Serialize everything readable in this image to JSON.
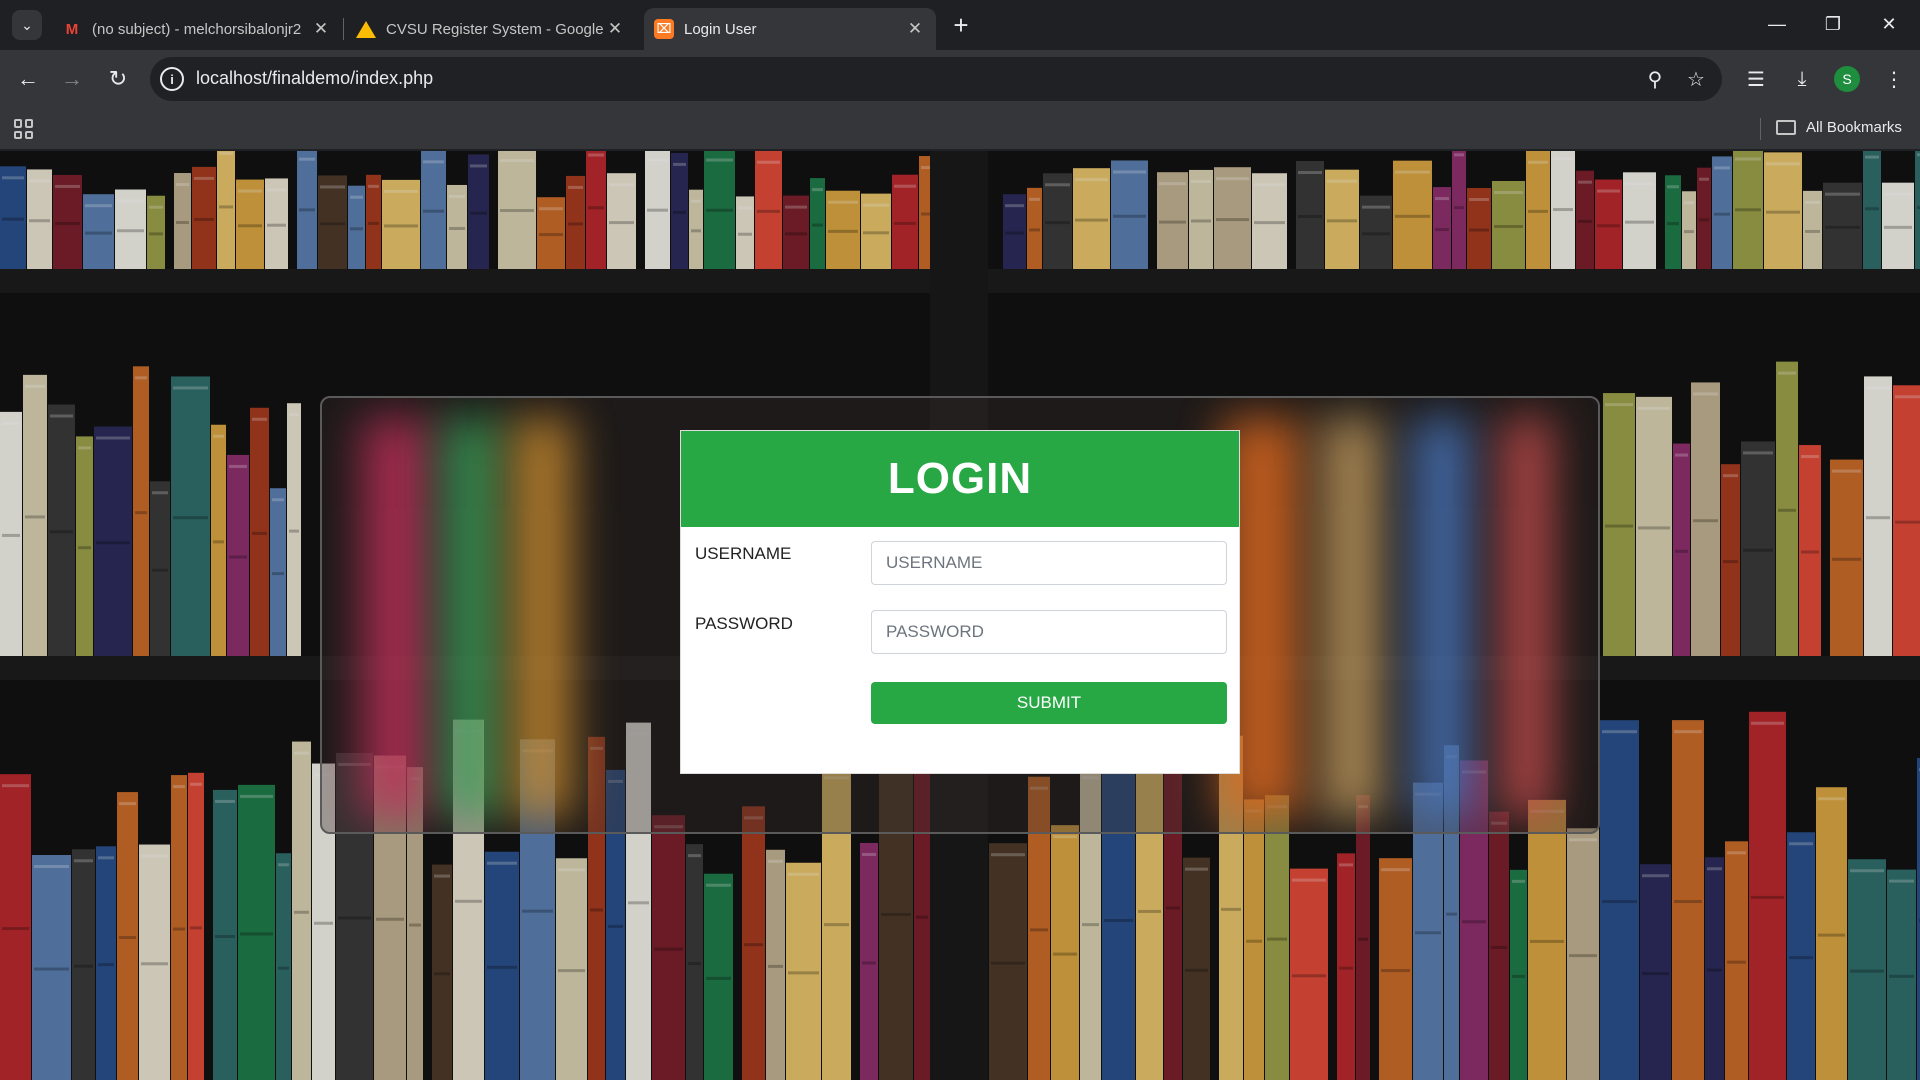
{
  "browser": {
    "tabs": [
      {
        "title": "(no subject) - melchorsibalonjr2",
        "favicon": "gmail-icon",
        "active": false
      },
      {
        "title": "CVSU Register System - Google",
        "favicon": "google-drive-icon",
        "active": false
      },
      {
        "title": "Login User",
        "favicon": "xampp-icon",
        "active": true
      }
    ],
    "address_bar": {
      "url": "localhost/finaldemo/index.php"
    },
    "profile_initial": "S",
    "bookmarks_label": "All Bookmarks"
  },
  "page": {
    "login": {
      "title": "LOGIN",
      "username_label": "USERNAME",
      "username_placeholder": "USERNAME",
      "password_label": "PASSWORD",
      "password_placeholder": "PASSWORD",
      "submit_label": "SUBMIT"
    },
    "colors": {
      "accent": "#28a745",
      "card_bg": "#ffffff"
    }
  }
}
